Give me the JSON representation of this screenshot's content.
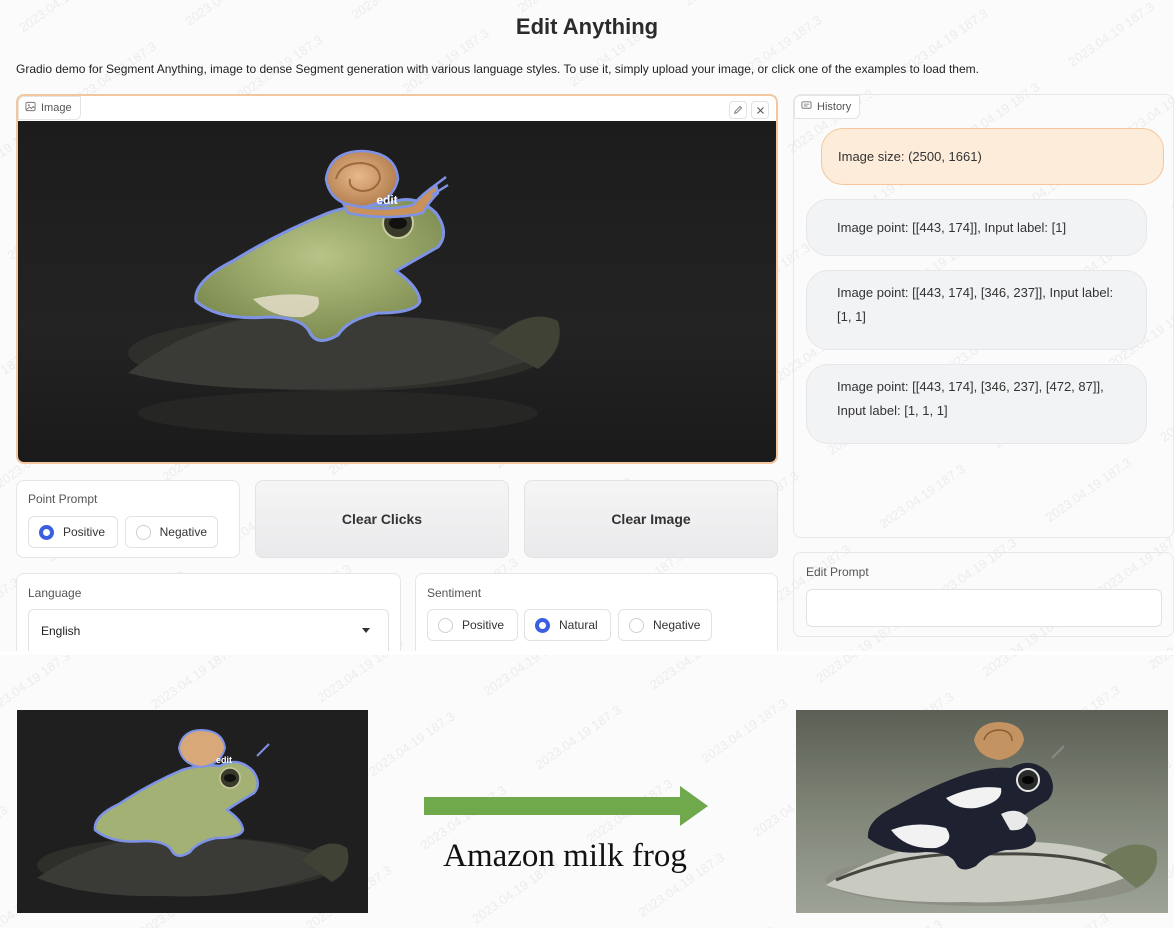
{
  "title": "Edit Anything",
  "description": "Gradio demo for Segment Anything, image to dense Segment generation with various language styles. To use it, simply upload your image, or click one of the examples to load them.",
  "image_panel": {
    "label": "Image",
    "edit_icon": "pencil-icon",
    "close_icon": "close-icon",
    "mask_label": "edit"
  },
  "history": {
    "label": "History",
    "messages": [
      {
        "role": "user",
        "text": "Image size: (2500, 1661)"
      },
      {
        "role": "bot",
        "text": "Image point: [[443, 174]], Input label: [1]"
      },
      {
        "role": "bot",
        "text": "Image point: [[443, 174], [346, 237]], Input label: [1, 1]"
      },
      {
        "role": "bot",
        "text": "Image point: [[443, 174], [346, 237], [472, 87]], Input label: [1, 1, 1]"
      }
    ]
  },
  "point_prompt": {
    "label": "Point Prompt",
    "options": [
      "Positive",
      "Negative"
    ],
    "selected": "Positive"
  },
  "buttons": {
    "clear_clicks": "Clear Clicks",
    "clear_image": "Clear Image"
  },
  "language": {
    "label": "Language",
    "selected": "English"
  },
  "sentiment": {
    "label": "Sentiment",
    "options": [
      "Positive",
      "Natural",
      "Negative"
    ],
    "selected": "Natural"
  },
  "edit_prompt": {
    "label": "Edit Prompt",
    "value": ""
  },
  "result": {
    "input_mask_label": "edit",
    "arrow_color": "#70a84c",
    "caption": "Amazon milk frog"
  },
  "colors": {
    "accent": "#3a5fe0",
    "user_bubble": "#fdecd9",
    "mask_outline": "#7f93e6"
  }
}
